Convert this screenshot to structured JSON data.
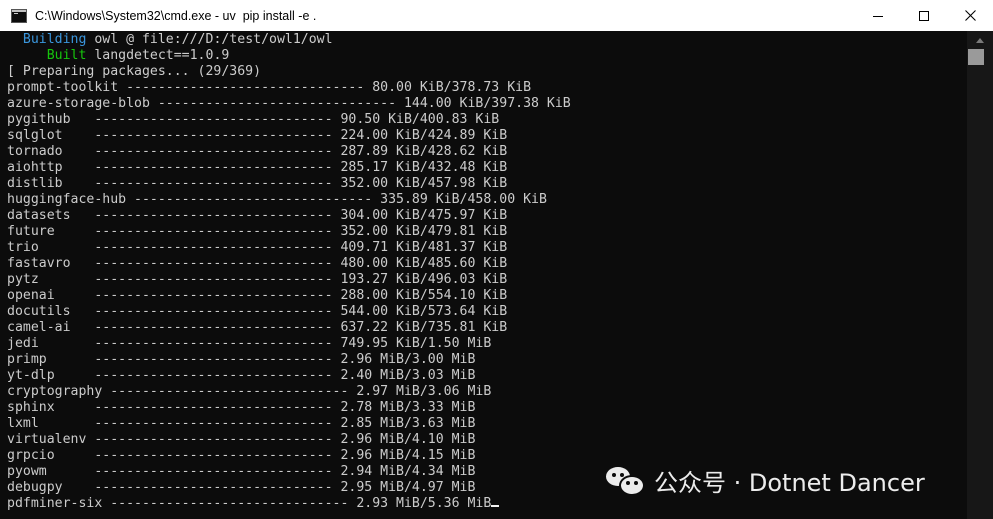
{
  "window": {
    "title": "C:\\Windows\\System32\\cmd.exe - uv  pip install -e ."
  },
  "terminal": {
    "header": [
      {
        "prefix": "  Building",
        "rest": " owl @ file:///D:/test/owl1/owl"
      },
      {
        "prefix": "     Built",
        "rest": " langdetect==1.0.9"
      },
      {
        "prefix": "",
        "rest": "[ Preparing packages... (29/369)"
      }
    ],
    "packages": [
      "prompt-toolkit ------------------------------ 80.00 KiB/378.73 KiB",
      "azure-storage-blob ------------------------------ 144.00 KiB/397.38 KiB",
      "pygithub   ------------------------------ 90.50 KiB/400.83 KiB",
      "sqlglot    ------------------------------ 224.00 KiB/424.89 KiB",
      "tornado    ------------------------------ 287.89 KiB/428.62 KiB",
      "aiohttp    ------------------------------ 285.17 KiB/432.48 KiB",
      "distlib    ------------------------------ 352.00 KiB/457.98 KiB",
      "huggingface-hub ------------------------------ 335.89 KiB/458.00 KiB",
      "datasets   ------------------------------ 304.00 KiB/475.97 KiB",
      "future     ------------------------------ 352.00 KiB/479.81 KiB",
      "trio       ------------------------------ 409.71 KiB/481.37 KiB",
      "fastavro   ------------------------------ 480.00 KiB/485.60 KiB",
      "pytz       ------------------------------ 193.27 KiB/496.03 KiB",
      "openai     ------------------------------ 288.00 KiB/554.10 KiB",
      "docutils   ------------------------------ 544.00 KiB/573.64 KiB",
      "camel-ai   ------------------------------ 637.22 KiB/735.81 KiB",
      "jedi       ------------------------------ 749.95 KiB/1.50 MiB",
      "primp      ------------------------------ 2.96 MiB/3.00 MiB",
      "yt-dlp     ------------------------------ 2.40 MiB/3.03 MiB",
      "cryptography ------------------------------ 2.97 MiB/3.06 MiB",
      "sphinx     ------------------------------ 2.78 MiB/3.33 MiB",
      "lxml       ------------------------------ 2.85 MiB/3.63 MiB",
      "virtualenv ------------------------------ 2.96 MiB/4.10 MiB",
      "grpcio     ------------------------------ 2.96 MiB/4.15 MiB",
      "pyowm      ------------------------------ 2.94 MiB/4.34 MiB",
      "debugpy    ------------------------------ 2.95 MiB/4.97 MiB",
      "pdfminer-six ------------------------------ 2.93 MiB/5.36 MiB"
    ]
  },
  "watermark": {
    "text": "公众号 · Dotnet Dancer"
  },
  "colors": {
    "background": "#0c0c0c",
    "text": "#cccccc",
    "building": "#3a96dd",
    "built": "#16c60c"
  }
}
